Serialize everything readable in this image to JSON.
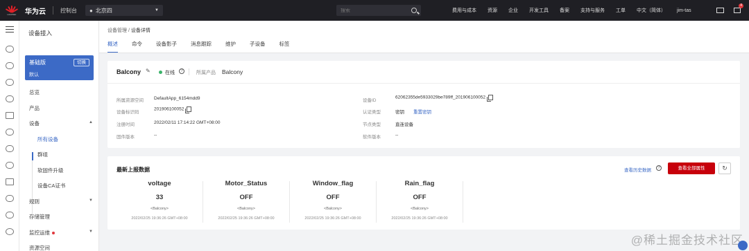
{
  "topbar": {
    "brand": "华为云",
    "logo_text": "HUAWEI",
    "console": "控制台",
    "region": "北京四",
    "search_placeholder": "搜索",
    "nav": [
      "费用与成本",
      "资源",
      "企业",
      "开发工具",
      "备案",
      "支持与服务",
      "工单",
      "中文（简体）",
      "jim-tas"
    ],
    "mail_badge": "4"
  },
  "sidebar": {
    "title": "设备接入",
    "edition_name": "基础版",
    "edition_sub": "默认",
    "switch_label": "切换",
    "items": [
      "总览",
      "产品",
      "设备",
      "所有设备",
      "群组",
      "软固件升级",
      "设备CA证书",
      "规则",
      "存储管理",
      "监控运维",
      "资源空间"
    ]
  },
  "breadcrumb": {
    "parent": "设备管理",
    "sep": " / ",
    "current": "设备详情"
  },
  "tabs": [
    "概述",
    "命令",
    "设备影子",
    "消息跟踪",
    "维护",
    "子设备",
    "标签"
  ],
  "device": {
    "name": "Balcony",
    "status": "在线",
    "product_label": "所属产品",
    "product_value": "Balcony",
    "left": [
      {
        "label": "所属资源空间",
        "value": "DefaultApp_6154mdd9"
      },
      {
        "label": "设备标识码",
        "value": "201906100052"
      },
      {
        "label": "注册时间",
        "value": "2022/02/11 17:14:22 GMT+08:00"
      },
      {
        "label": "固件版本",
        "value": "--"
      }
    ],
    "right": [
      {
        "label": "设备ID",
        "value": "62062355de5933029be789ff_201906100052"
      },
      {
        "label": "认证类型",
        "value": "密钥",
        "link": "重置密钥"
      },
      {
        "label": "节点类型",
        "value": "直连设备"
      },
      {
        "label": "软件版本",
        "value": "--"
      }
    ]
  },
  "latest": {
    "title": "最新上报数据",
    "history_link": "查看历史数据",
    "all_props_button": "查看全部属性",
    "props": [
      {
        "name": "voltage",
        "value": "33",
        "service": "<Balcony>",
        "time": "2022/02/25 19:36:26 GMT+08:00"
      },
      {
        "name": "Motor_Status",
        "value": "OFF",
        "service": "<Balcony>",
        "time": "2022/02/25 19:36:26 GMT+08:00"
      },
      {
        "name": "Window_flag",
        "value": "OFF",
        "service": "<Balcony>",
        "time": "2022/02/25 19:36:26 GMT+08:00"
      },
      {
        "name": "Rain_flag",
        "value": "OFF",
        "service": "<Balcony>",
        "time": "2022/02/25 19:36:26 GMT+08:00"
      }
    ]
  },
  "watermark": "@稀土掘金技术社区",
  "colors": {
    "accent": "#3c6ac6",
    "brand_red": "#c7000b",
    "topbar": "#1f1f24",
    "online": "#3bb36a"
  }
}
